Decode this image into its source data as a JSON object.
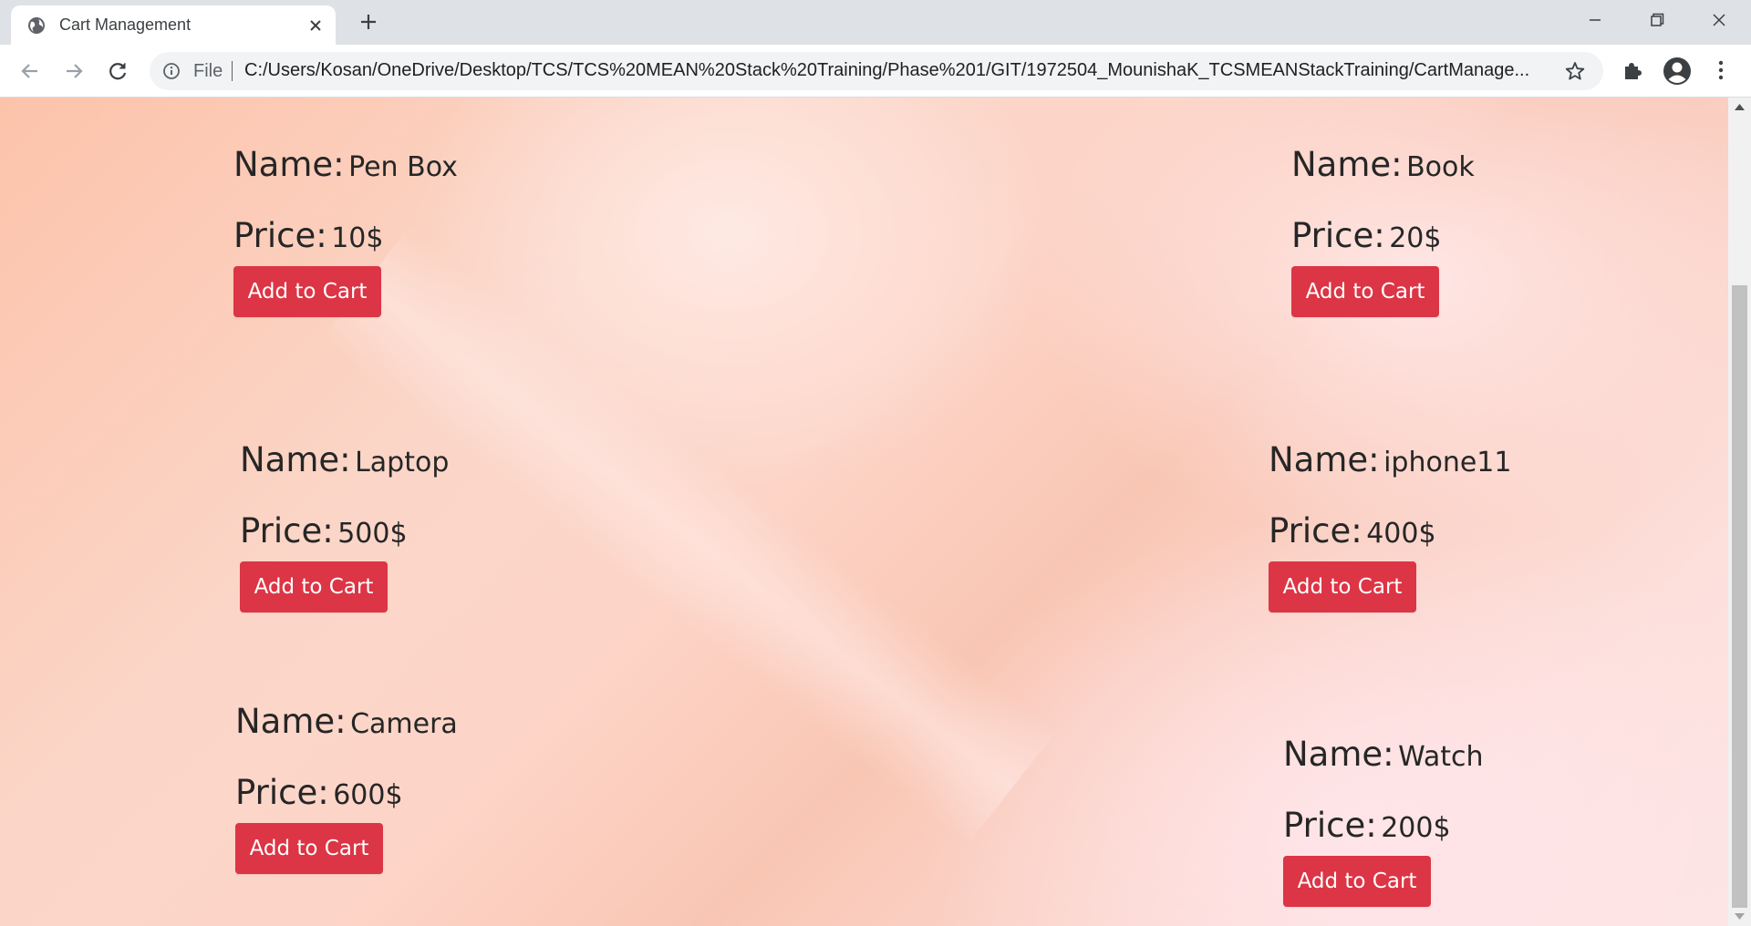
{
  "browser": {
    "tab_title": "Cart Management",
    "address_scheme": "File",
    "url": "C:/Users/Kosan/OneDrive/Desktop/TCS/TCS%20MEAN%20Stack%20Training/Phase%201/GIT/1972504_MounishaK_TCSMEANStackTraining/CartManage...",
    "icons": [
      "globe-icon",
      "close-icon",
      "new-tab-icon",
      "minimize-icon",
      "restore-icon",
      "window-close-icon",
      "back-icon",
      "forward-icon",
      "reload-icon",
      "info-icon",
      "star-icon",
      "extensions-icon",
      "profile-icon",
      "menu-icon"
    ]
  },
  "page": {
    "name_label": "Name:",
    "price_label": "Price:",
    "products": [
      {
        "name": "Pen Box",
        "price": "10$",
        "button": "Add to Cart"
      },
      {
        "name": "Book",
        "price": "20$",
        "button": "Add to Cart"
      },
      {
        "name": "Laptop",
        "price": "500$",
        "button": "Add to Cart"
      },
      {
        "name": "iphone11",
        "price": "400$",
        "button": "Add to Cart"
      },
      {
        "name": "Camera",
        "price": "600$",
        "button": "Add to Cart"
      },
      {
        "name": "Watch",
        "price": "200$",
        "button": "Add to Cart"
      }
    ],
    "colors": {
      "button": "#dc3545",
      "button_text": "#ffffff"
    }
  }
}
